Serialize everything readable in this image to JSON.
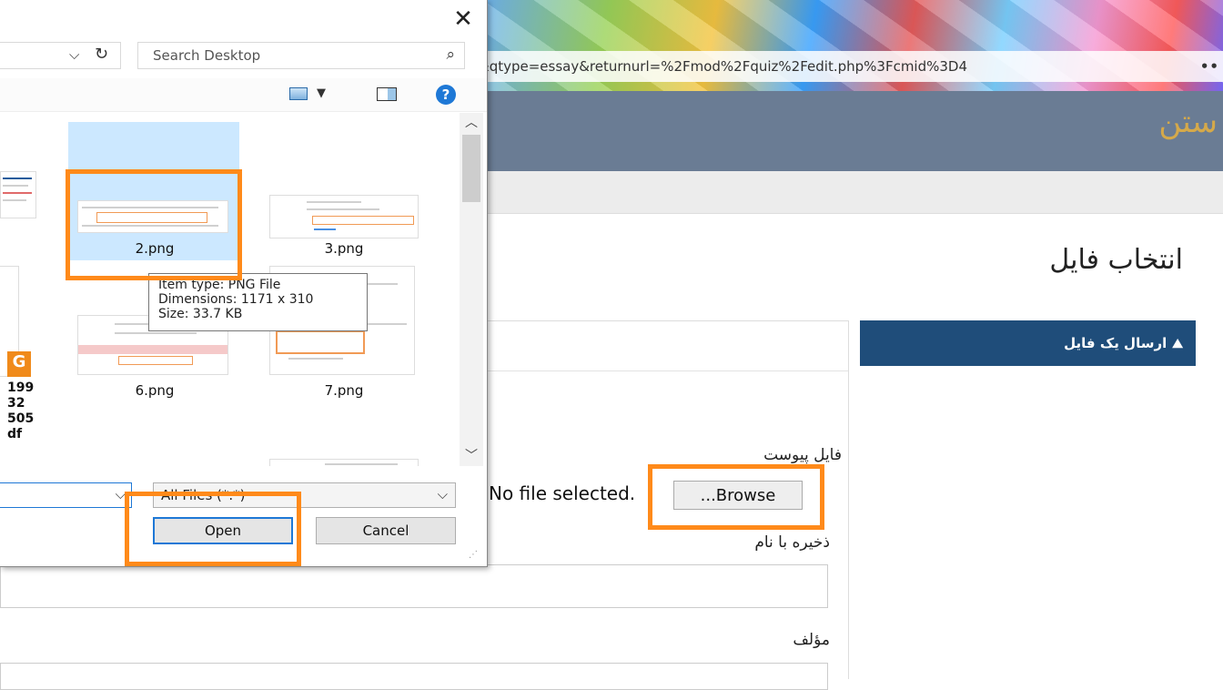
{
  "browser": {
    "url": "&qtype=essay&returnurl=%2Fmod%2Fquiz%2Fedit.php%3Fcmid%3D4",
    "more": "••",
    "logo_text": "ستن"
  },
  "page": {
    "title": "انتخاب فایل",
    "upload_button": "ارسال یک فایل",
    "attachment_label": "فایل پیوست",
    "browse_button": "...Browse",
    "no_file": "No file selected.",
    "save_as_label": "ذخیره با نام",
    "author_label": "مؤلف"
  },
  "dialog": {
    "search_placeholder": "Search Desktop",
    "files": [
      {
        "name": "2.png"
      },
      {
        "name": "3.png"
      },
      {
        "name": "6.png"
      },
      {
        "name": "7.png"
      }
    ],
    "cut_off_lines": [
      "199",
      "32",
      "505",
      "df"
    ],
    "tooltip": {
      "type": "Item type: PNG File",
      "dims": "Dimensions: 1171 x 310",
      "size": "Size: 33.7 KB"
    },
    "file_type": "All Files (*.*)",
    "open_button": "Open",
    "cancel_button": "Cancel"
  },
  "colors": {
    "highlight": "#ff8a1a",
    "header": "#6a7c94",
    "side_button": "#1f4d7a"
  }
}
